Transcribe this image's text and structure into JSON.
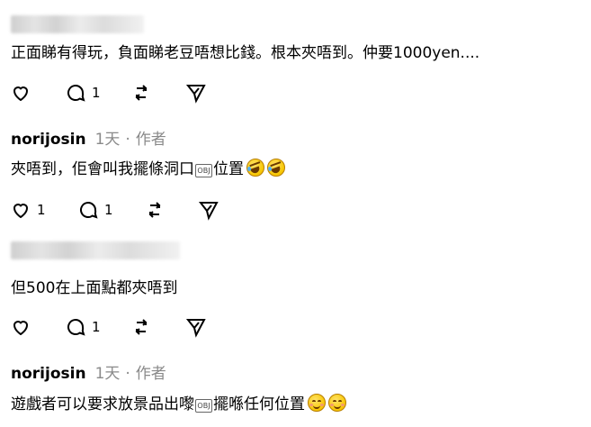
{
  "comments": [
    {
      "author_hidden": true,
      "text": "正面睇有得玩，負面睇老豆唔想比錢。根本夾唔到。仲要1000yen....",
      "likes": "",
      "replies": "1"
    },
    {
      "author": "norijosin",
      "time": "1天",
      "sep": "·",
      "role": "作者",
      "text_before": "夾唔到，佢會叫我擺條洞口",
      "text_after": "位置",
      "likes": "1",
      "replies": "1"
    },
    {
      "author_hidden": true,
      "text": "但500在上面點都夾唔到",
      "likes": "",
      "replies": "1"
    },
    {
      "author": "norijosin",
      "time": "1天",
      "sep": "·",
      "role": "作者",
      "text_before": "遊戲者可以要求放景品出嚟",
      "text_after": "擺喺任何位置"
    }
  ],
  "unknown_glyph_label": "OBJ",
  "icons": {
    "like": "heart-icon",
    "reply": "comment-icon",
    "repost": "repost-icon",
    "share": "send-icon"
  },
  "emojis": [
    "rolling-laughing-emoji",
    "smiling-blush-emoji"
  ]
}
